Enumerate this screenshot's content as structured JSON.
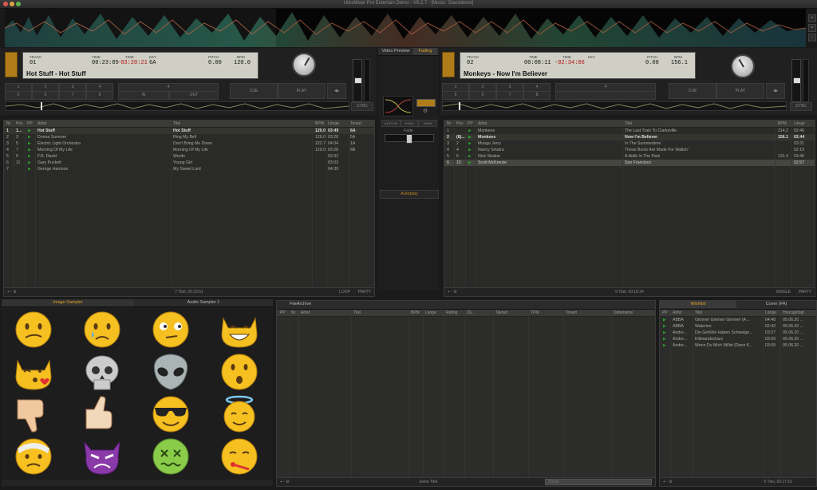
{
  "window": {
    "title": "UltraMixer Pro Entertain Demo - V6.2.7 - [Music: Standalone]"
  },
  "deck1": {
    "track_lbl": "TRACK",
    "track": "01",
    "time_lbl": "TIME",
    "time": "00:23:85",
    "remain_lbl": "TIME",
    "remain": "-03:20:21",
    "key_lbl": "KEY",
    "key": "6A",
    "pitch_lbl": "PITCH",
    "pitch": "0.00",
    "bpm_lbl": "BPM",
    "bpm": "120.0",
    "title": "Hot Stuff - Hot Stuff",
    "cue": "CUE",
    "play": "PLAY",
    "sync": "SYNC",
    "hotcues": [
      "1",
      "2",
      "3",
      "4",
      "5",
      "6",
      "7",
      "8"
    ],
    "loop_in": "IN",
    "loop_out": "OUT"
  },
  "deck2": {
    "track_lbl": "TRACK",
    "track": "02",
    "time_lbl": "TIME",
    "time": "00:08:11",
    "remain_lbl": "TIME",
    "remain": "-02:34:06",
    "key_lbl": "KEY",
    "key": "",
    "pitch_lbl": "PITCH",
    "pitch": "0.00",
    "bpm_lbl": "BPM",
    "bpm": "156.1",
    "title": "Monkeys - Now I'm Believer",
    "cue": "CUE",
    "play": "PLAY",
    "sync": "SYNC",
    "hotcues": [
      "1",
      "2",
      "3",
      "4",
      "5",
      "6",
      "7",
      "8"
    ]
  },
  "center": {
    "video_preview": "Video Preview",
    "fading": "Fading",
    "autoplay": "Autoplay",
    "crossfader_lbl": "Fade",
    "mode_btns": [
      "AUTO IN",
      "SYNC",
      "FADE"
    ]
  },
  "playlist_left": {
    "columns": [
      "Nr",
      "Pos",
      "PP",
      "Artist",
      "Titel",
      "BPM",
      "Länge",
      "Tonart"
    ],
    "rows": [
      {
        "nr": "1",
        "pos": "1...",
        "artist": "Hot Stuff",
        "title": "Hot Stuff",
        "bpm": "120.0",
        "len": "03:49",
        "key": "6A"
      },
      {
        "nr": "2",
        "pos": "3",
        "artist": "Donna Summer",
        "title": "Ring My Bell",
        "bpm": "126.0",
        "len": "03:28",
        "key": "5A"
      },
      {
        "nr": "3",
        "pos": "5",
        "artist": "Electric Light Orchestra",
        "title": "Don't Bring Me Down",
        "bpm": "222.7",
        "len": "04:04",
        "key": "1A"
      },
      {
        "nr": "4",
        "pos": "7",
        "artist": "Morning Of My Life",
        "title": "Morning Of My Life",
        "bpm": "129.0",
        "len": "03:28",
        "key": "6B"
      },
      {
        "nr": "5",
        "pos": "9",
        "artist": "F.R. David",
        "title": "Words",
        "bpm": "",
        "len": "03:32",
        "key": ""
      },
      {
        "nr": "6",
        "pos": "11",
        "artist": "Gary Puckett",
        "title": "Young Girl",
        "bpm": "",
        "len": "03:03",
        "key": ""
      },
      {
        "nr": "7",
        "pos": "",
        "artist": "George Harrison",
        "title": "My Sweet Lord",
        "bpm": "",
        "len": "04:39",
        "key": ""
      }
    ],
    "footer": "7 Titel, 00:23:61",
    "footer_btns": [
      "LOOP",
      "PARTY"
    ]
  },
  "playlist_right": {
    "columns": [
      "Nr",
      "Pos",
      "PP",
      "Artist",
      "Titel",
      "BPM",
      "Länge"
    ],
    "rows": [
      {
        "nr": "1",
        "pos": "",
        "artist": "Monkees",
        "title": "The Last Train To Clarksville",
        "bpm": "214.2",
        "len": "02:46"
      },
      {
        "nr": "2",
        "pos": "(8)...",
        "artist": "Monkees",
        "title": "Now I'm Believer",
        "bpm": "156.1",
        "len": "02:44"
      },
      {
        "nr": "3",
        "pos": "2",
        "artist": "Mungo Jerry",
        "title": "In The Summertime",
        "bpm": "",
        "len": "03:31"
      },
      {
        "nr": "4",
        "pos": "4",
        "artist": "Nancy Sinatra",
        "title": "These Boots Are Made For Walkin'",
        "bpm": "",
        "len": "02:19"
      },
      {
        "nr": "5",
        "pos": "6",
        "artist": "Nick Straker",
        "title": "A Walk In The Park",
        "bpm": "131.4",
        "len": "03:46"
      },
      {
        "nr": "6",
        "pos": "10",
        "artist": "Scott McKenzie",
        "title": "San Francisco",
        "bpm": "",
        "len": "02:57"
      }
    ],
    "footer": "6 Titel, 00:18:24",
    "footer_btns": [
      "SINGLE",
      "PARTY"
    ]
  },
  "sampler": {
    "tab1": "Image Sampler",
    "tab2": "Audio Sampler 1",
    "images": [
      "confused-face",
      "sad-tear-face",
      "smirk-eyes-face",
      "grinning-cat",
      "kissing-cat",
      "skull",
      "alien",
      "surprised-face",
      "thumbs-down",
      "thumbs-up",
      "sunglasses-face",
      "halo-face",
      "bandaged-face",
      "angry-devil",
      "dizzy-sick-face",
      "thermometer-face"
    ]
  },
  "filearchive": {
    "tab": "FileArchive",
    "columns": [
      "PP",
      "Nr",
      "Artist",
      "Titel",
      "BPM",
      "Länge",
      "Rating",
      "Zä...",
      "Taktart",
      "TPM",
      "Tonart",
      "Dateiname"
    ],
    "footer": "keine Titel",
    "search_placeholder": "Suche"
  },
  "wishlist": {
    "tab1": "Wishlist",
    "tab2": "Cover (FA)",
    "columns": [
      "PP",
      "Artist",
      "Titel",
      "Länge",
      "Hinzugefügt"
    ],
    "rows": [
      {
        "artist": "ABBA",
        "title": "Gimme! Gimme! Gimme! (A ...",
        "len": "04:48",
        "added": "05.06.20 ..."
      },
      {
        "artist": "ABBA",
        "title": "Waterloo",
        "len": "02:43",
        "added": "05.06.20 ..."
      },
      {
        "artist": "Andre...",
        "title": "Die Gefühle Haben Schweige...",
        "len": "03:27",
        "added": "05.06.20 ..."
      },
      {
        "artist": "Andre...",
        "title": "Kilimandscharo",
        "len": "03:09",
        "added": "05.06.20 ..."
      },
      {
        "artist": "Andre...",
        "title": "Wenn Du Mich Willst (Dann K...",
        "len": "03:09",
        "added": "05.06.20 ..."
      }
    ],
    "footer": "5 Titel, 00:17:16"
  }
}
